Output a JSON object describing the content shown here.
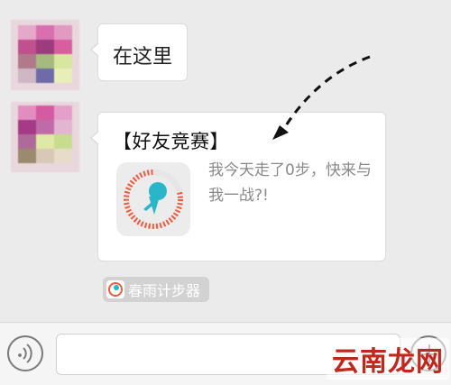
{
  "messages": [
    {
      "type": "text",
      "text": "在这里"
    },
    {
      "type": "card",
      "title": "【好友竞赛】",
      "message": "我今天走了0步，快来与我一战?!",
      "app_icon": "running-figure-icon"
    }
  ],
  "source": {
    "label": "春雨计步器",
    "icon": "pedometer-app-icon"
  },
  "input_bar": {
    "placeholder": "",
    "voice_icon": "voice-icon",
    "more_icon": "plus-icon"
  },
  "watermark": {
    "text": "云南龙网"
  },
  "colors": {
    "background": "#ebebeb",
    "bubble": "#ffffff",
    "progress_ring": "#f05a3c",
    "figure": "#29b6c9",
    "watermark": "#c0281e"
  }
}
